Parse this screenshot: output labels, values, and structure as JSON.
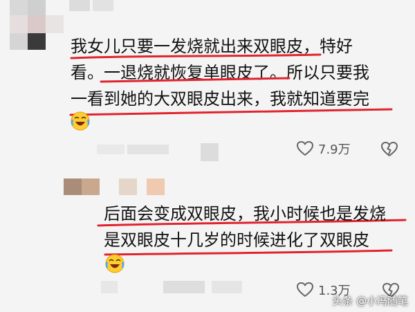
{
  "comments": [
    {
      "lines": [
        "我女儿只要一发烧就出来双眼皮，特好",
        "看。一退烧就恢复单眼皮了。所以只要我",
        "一看到她的大双眼皮出来，我就知道要完"
      ],
      "emoji_icon": "crying-laughing-emoji-icon",
      "like_count": "7.9万",
      "like_icon": "heart-outline-icon",
      "dislike_icon": "broken-heart-icon"
    },
    {
      "lines": [
        "后面会变成双眼皮，我小时候也是发烧",
        "是双眼皮十几岁的时候进化了双眼皮"
      ],
      "emoji_icon": "crying-laughing-emoji-icon",
      "like_count": "1.3万",
      "like_icon": "heart-outline-icon",
      "dislike_icon": "broken-heart-icon"
    }
  ],
  "watermark": "头条 @小冯随笔",
  "colors": {
    "underline": "#e0232e",
    "text": "#111111",
    "count": "#555555",
    "background": "#f4f4f4"
  }
}
